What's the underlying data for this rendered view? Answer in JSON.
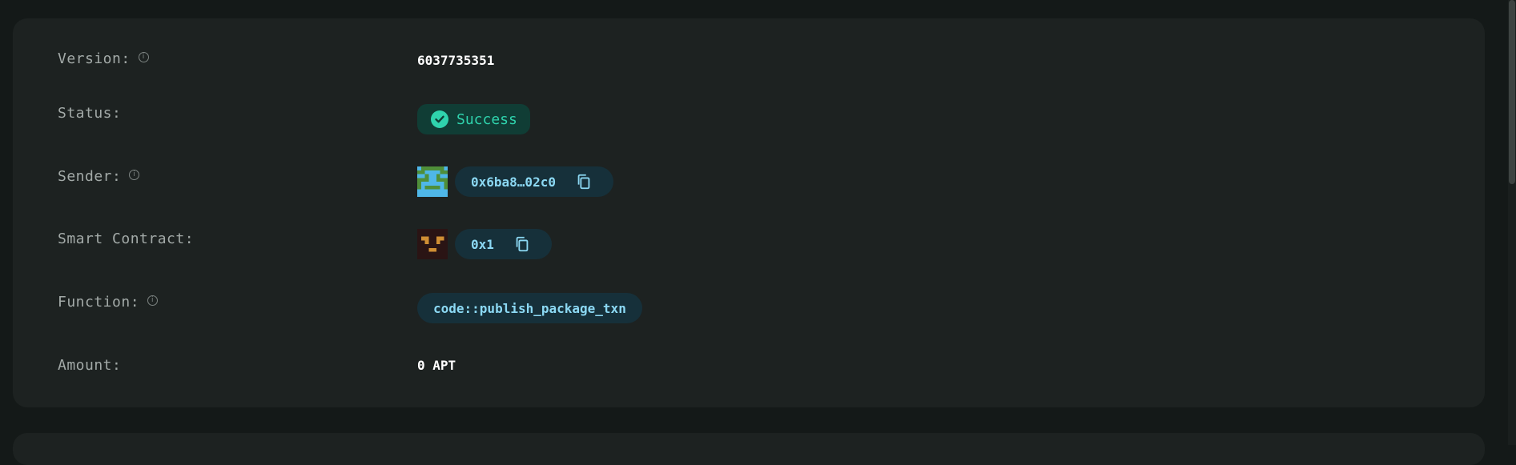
{
  "rows": {
    "version": {
      "label": "Version:",
      "value": "6037735351"
    },
    "status": {
      "label": "Status:",
      "value": "Success"
    },
    "sender": {
      "label": "Sender:",
      "value": "0x6ba8…02c0"
    },
    "smart_contract": {
      "label": "Smart Contract:",
      "value": "0x1"
    },
    "function": {
      "label": "Function:",
      "value": "code::publish_package_txn"
    },
    "amount": {
      "label": "Amount:",
      "value": "0 APT"
    }
  },
  "icons": {
    "info": "info-icon",
    "check": "check-circle-icon",
    "copy": "copy-icon"
  },
  "colors": {
    "background": "#141918",
    "card": "#1d2221",
    "success": "#2fd3ad",
    "success_bg": "#103d35",
    "address_text": "#8cd9f4",
    "address_bg": "#16303a"
  }
}
